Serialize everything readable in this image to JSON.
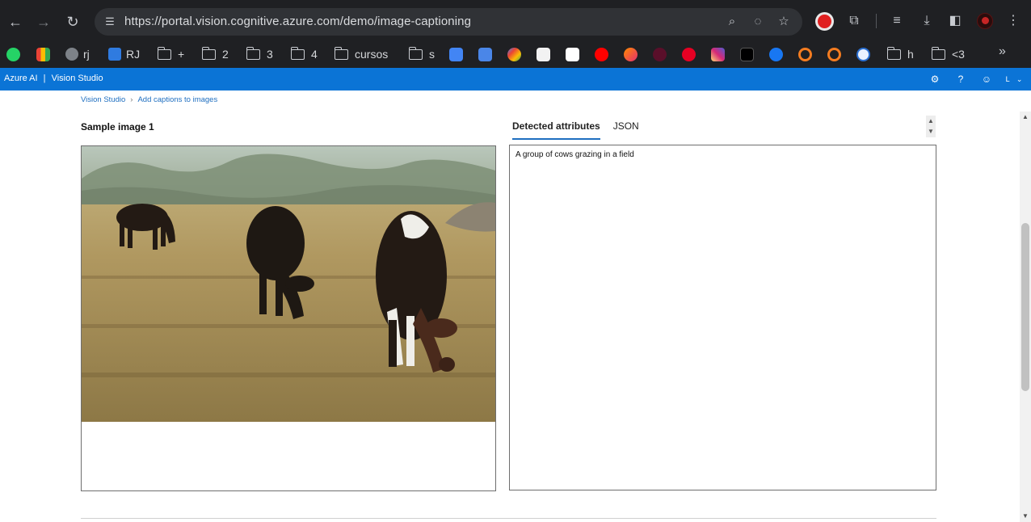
{
  "browser": {
    "url": "https://portal.vision.cognitive.azure.com/demo/image-captioning",
    "bookmarks": [
      "rj",
      "RJ",
      "+",
      "2",
      "3",
      "4",
      "cursos",
      "s",
      "h",
      "<3"
    ]
  },
  "azure": {
    "brand": "Azure AI",
    "separator": "|",
    "product": "Vision Studio",
    "user_initial": "L"
  },
  "breadcrumb": {
    "home": "Vision Studio",
    "separator": "›",
    "current": "Add captions to images"
  },
  "sample": {
    "title": "Sample image 1"
  },
  "tabs": {
    "detected": "Detected attributes",
    "json": "JSON"
  },
  "result": {
    "caption": "A group of cows grazing in a field"
  },
  "colors": {
    "azure_bar": "#0b74d6",
    "link": "#1f6fc0",
    "chrome_bg": "#1f2023"
  }
}
